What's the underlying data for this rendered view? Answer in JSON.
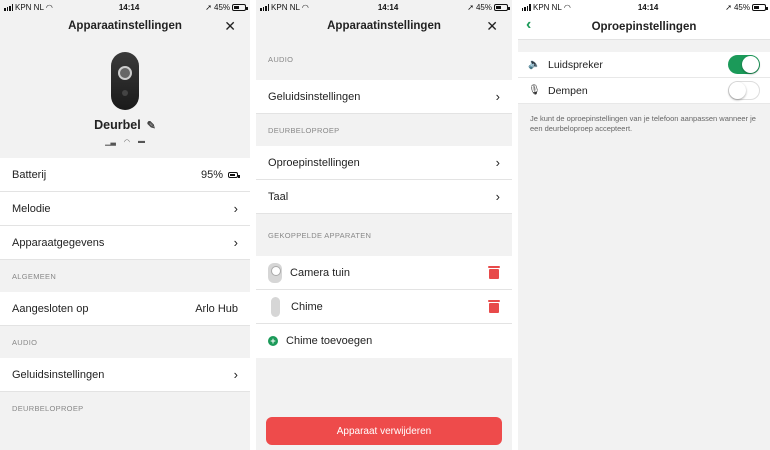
{
  "status": {
    "carrier": "KPN NL",
    "time": "14:14",
    "battery": "45%"
  },
  "screen1": {
    "title": "Apparaatinstellingen",
    "device_name": "Deurbel",
    "rows_top": [
      {
        "label": "Batterij",
        "value": "95%"
      },
      {
        "label": "Melodie",
        "value": ""
      },
      {
        "label": "Apparaatgegevens",
        "value": ""
      }
    ],
    "section_general": "ALGEMEEN",
    "connected_label": "Aangesloten op",
    "connected_value": "Arlo Hub",
    "section_audio": "AUDIO",
    "sound_label": "Geluidsinstellingen",
    "section_call": "DEURBELOPROEP"
  },
  "screen2": {
    "title": "Apparaatinstellingen",
    "section_audio": "AUDIO",
    "sound_label": "Geluidsinstellingen",
    "section_call": "DEURBELOPROEP",
    "call_settings_label": "Oproepinstellingen",
    "language_label": "Taal",
    "section_linked": "GEKOPPELDE APPARATEN",
    "linked": [
      {
        "name": "Camera tuin"
      },
      {
        "name": "Chime"
      }
    ],
    "add_chime_label": "Chime toevoegen",
    "remove_label": "Apparaat verwijderen"
  },
  "screen3": {
    "title": "Oproepinstellingen",
    "speaker_label": "Luidspreker",
    "speaker_on": true,
    "mute_label": "Dempen",
    "mute_on": false,
    "note": "Je kunt de oproepinstellingen van je telefoon aanpassen wanneer je een deurbeloproep accepteert."
  },
  "colors": {
    "accent": "#1b9a59",
    "danger": "#ee4b4b"
  }
}
